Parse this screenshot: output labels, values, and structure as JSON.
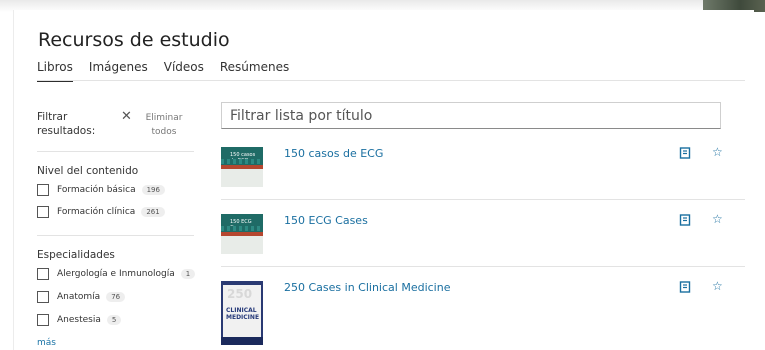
{
  "page": {
    "title": "Recursos de estudio"
  },
  "tabs": [
    {
      "label": "Libros",
      "active": true
    },
    {
      "label": "Imágenes",
      "active": false
    },
    {
      "label": "Vídeos",
      "active": false
    },
    {
      "label": "Resúmenes",
      "active": false
    }
  ],
  "filters": {
    "title": "Filtrar resultados:",
    "clear_icon": "close-icon",
    "clear_label": "Eliminar todos",
    "sections": [
      {
        "title": "Nivel del contenido",
        "options": [
          {
            "label": "Formación básica",
            "count": "196"
          },
          {
            "label": "Formación clínica",
            "count": "261"
          }
        ]
      },
      {
        "title": "Especialidades",
        "options": [
          {
            "label": "Alergología e Inmunología",
            "count": "1"
          },
          {
            "label": "Anatomía",
            "count": "76"
          },
          {
            "label": "Anestesia",
            "count": "5"
          }
        ]
      }
    ],
    "more_label": "más"
  },
  "search": {
    "placeholder": "Filtrar lista por título",
    "value": ""
  },
  "books": [
    {
      "title": "150 casos de ECG",
      "cover_text": "150 casos de ECG"
    },
    {
      "title": "150 ECG Cases",
      "cover_text": "150 ECG Cases"
    },
    {
      "title": "250 Cases in Clinical Medicine",
      "cover_number": "250",
      "cover_text": "CLINICAL MEDICINE"
    }
  ],
  "colors": {
    "link": "#1a6fa0",
    "text": "#333333",
    "divider": "#e3e3e3"
  },
  "icons": {
    "read": "book-icon",
    "favorite": "star-icon"
  }
}
